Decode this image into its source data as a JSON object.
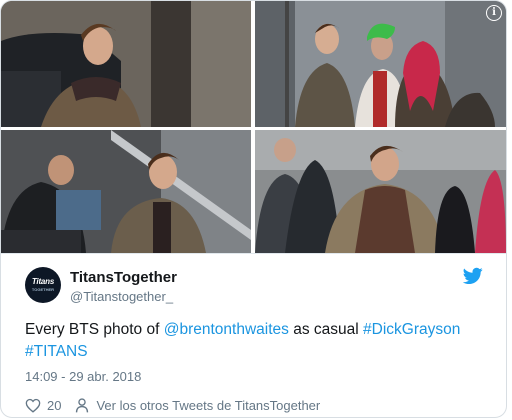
{
  "tweet": {
    "display_name": "TitansTogether",
    "handle": "@Titanstogether_",
    "avatar_text": "Titans",
    "avatar_subtext": "TOGETHER",
    "text_parts": [
      "Every BTS photo of ",
      "@brentonthwaites",
      " as casual ",
      "#DickGrayson",
      " ",
      "#TITANS"
    ],
    "timestamp": "14:09 - 29 abr. 2018",
    "likes": "20",
    "more_tweets_label": "Ver los otros Tweets de TitansTogether"
  },
  "media": {
    "photo_count": 4,
    "info_icon": "i"
  },
  "colors": {
    "link": "#1b95e0",
    "text": "#14171a",
    "secondary": "#657786",
    "twitter_blue": "#1da1f2",
    "border": "#e1e8ed"
  },
  "icons": [
    "info-icon",
    "twitter-bird-icon",
    "heart-icon",
    "person-icon"
  ]
}
